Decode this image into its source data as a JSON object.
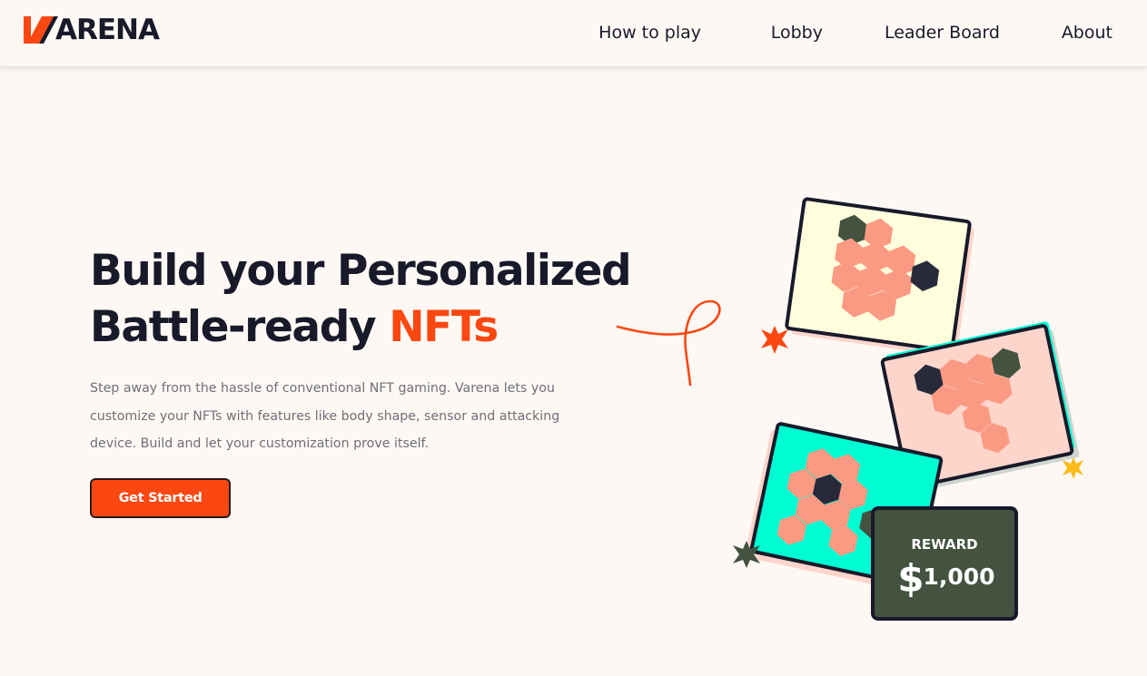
{
  "brand": {
    "name": "ARENA",
    "accent": "#fb4711",
    "ink": "#181a2a"
  },
  "nav": {
    "items": [
      {
        "label": "How to play"
      },
      {
        "label": "Lobby"
      },
      {
        "label": "Leader Board"
      },
      {
        "label": "About"
      }
    ]
  },
  "hero": {
    "headline_line1": "Build your Personalized",
    "headline_line2_a": "Battle-ready ",
    "headline_line2_b": "NFTs",
    "lede_line1": "Step away from the hassle of conventional NFT gaming. Varena lets you",
    "lede_line2": "customize your NFTs with features like body shape, sensor and attacking",
    "lede_line3": "device. Build and let your customization prove itself.",
    "cta_label": "Get Started"
  },
  "reward": {
    "label": "REWARD",
    "currency": "$",
    "amount": "1,000"
  },
  "colors": {
    "page_bg": "#fdf8f4",
    "card_cream": "#fefedd",
    "card_pink": "#fdd5cb",
    "card_teal": "#00fcd3",
    "hex_salmon": "#fb9a83",
    "hex_green": "#435340",
    "hex_navy": "#282a3c",
    "star_yellow": "#fbbb18",
    "reward_bg": "#435340"
  },
  "icons": [
    "logo-slash-icon",
    "star-orange-icon",
    "star-yellow-icon",
    "star-green-icon",
    "squiggle-line-icon"
  ]
}
